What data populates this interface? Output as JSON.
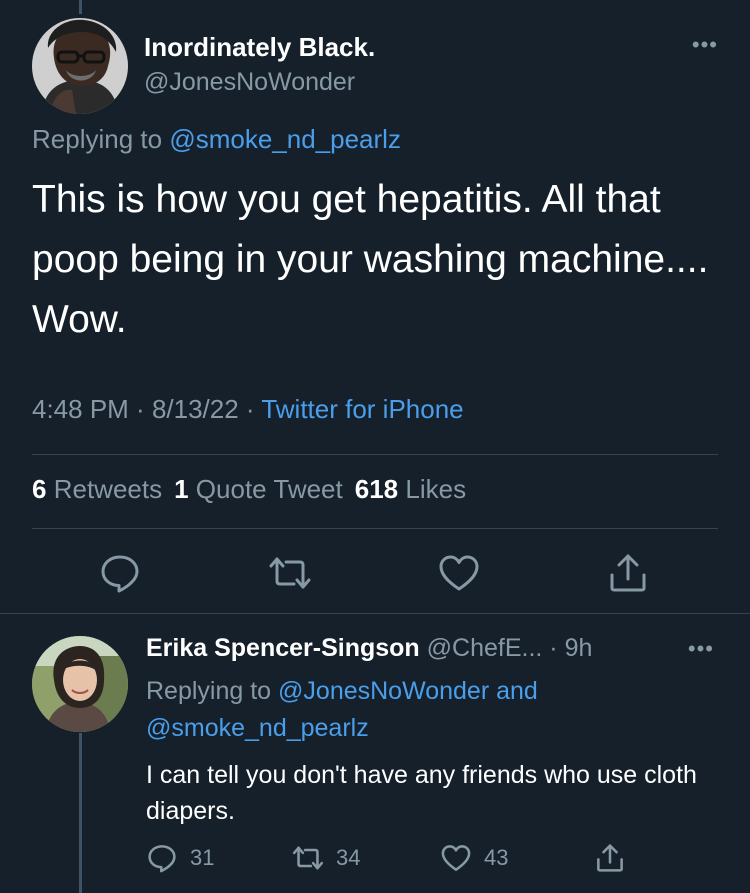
{
  "main_tweet": {
    "display_name": "Inordinately Black.",
    "handle": "@JonesNoWonder",
    "replying_prefix": "Replying to ",
    "replying_to": "@smoke_nd_pearlz",
    "text": "This is how you get hepatitis. All that poop being in your washing machine.... Wow.",
    "time": "4:48 PM",
    "date": "8/13/22",
    "separator": " · ",
    "source": "Twitter for iPhone",
    "stats": {
      "retweets_count": "6",
      "retweets_label": "Retweets",
      "quotes_count": "1",
      "quotes_label": "Quote Tweet",
      "likes_count": "618",
      "likes_label": "Likes"
    },
    "actions": [
      "reply-icon",
      "retweet-icon",
      "like-icon",
      "share-icon"
    ]
  },
  "reply": {
    "display_name": "Erika Spencer-Singson",
    "handle": "@ChefE...",
    "age": "9h",
    "replying_prefix": "Replying to ",
    "replying_to_1": "@JonesNoWonder",
    "replying_and": " and ",
    "replying_to_2": "@smoke_nd_pearlz",
    "text": "I can tell you don't have any friends who use cloth diapers.",
    "reply_count": "31",
    "retweet_count": "34",
    "like_count": "43"
  },
  "more_glyph": "•••",
  "colors": {
    "background": "#15202b",
    "text": "#ffffff",
    "secondary": "#8899a6",
    "link": "#4a9eea",
    "divider": "#38444d"
  }
}
